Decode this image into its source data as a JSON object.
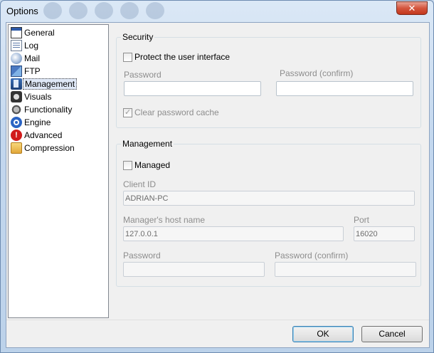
{
  "window": {
    "title": "Options",
    "close_label": "✕"
  },
  "tree": {
    "items": [
      {
        "label": "General",
        "icon": "general-icon"
      },
      {
        "label": "Log",
        "icon": "log-icon"
      },
      {
        "label": "Mail",
        "icon": "mail-icon"
      },
      {
        "label": "FTP",
        "icon": "ftp-icon"
      },
      {
        "label": "Management",
        "icon": "management-icon",
        "selected": true
      },
      {
        "label": "Visuals",
        "icon": "visuals-icon"
      },
      {
        "label": "Functionality",
        "icon": "functionality-icon"
      },
      {
        "label": "Engine",
        "icon": "engine-icon"
      },
      {
        "label": "Advanced",
        "icon": "advanced-icon"
      },
      {
        "label": "Compression",
        "icon": "compression-icon"
      }
    ]
  },
  "security": {
    "legend": "Security",
    "protect_ui": {
      "label": "Protect the user interface",
      "checked": false
    },
    "password_label": "Password",
    "password_value": "",
    "password_confirm_label": "Password (confirm)",
    "password_confirm_value": "",
    "clear_cache": {
      "label": "Clear password cache",
      "checked": true
    }
  },
  "management": {
    "legend": "Management",
    "managed": {
      "label": "Managed",
      "checked": false
    },
    "client_id_label": "Client ID",
    "client_id_value": "ADRIAN-PC",
    "host_label": "Manager's host name",
    "host_value": "127.0.0.1",
    "port_label": "Port",
    "port_value": "16020",
    "password_label": "Password",
    "password_value": "",
    "password_confirm_label": "Password (confirm)",
    "password_confirm_value": ""
  },
  "buttons": {
    "ok": "OK",
    "cancel": "Cancel"
  }
}
